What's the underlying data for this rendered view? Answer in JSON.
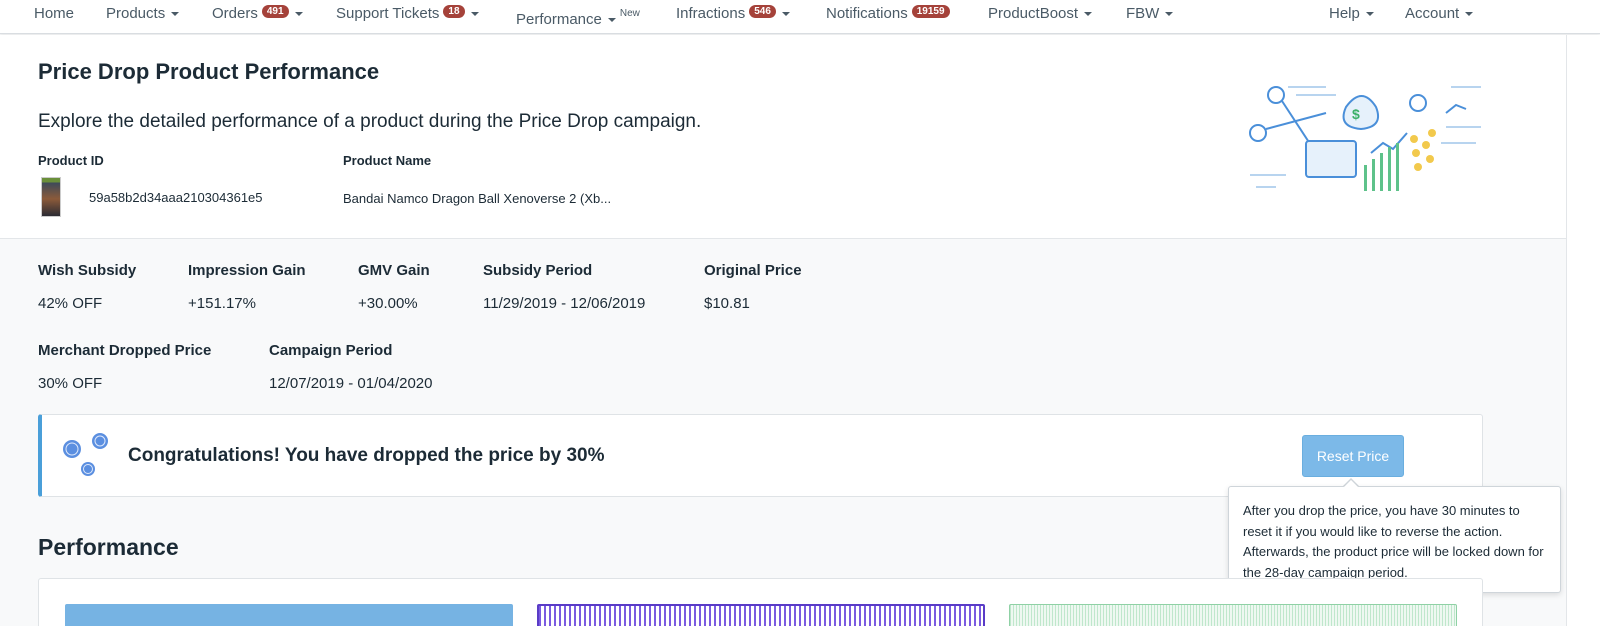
{
  "nav": {
    "home": "Home",
    "products": "Products",
    "orders": "Orders",
    "orders_badge": "491",
    "support": "Support Tickets",
    "support_badge": "18",
    "performance": "Performance",
    "performance_tag": "New",
    "infractions": "Infractions",
    "infractions_badge": "546",
    "notifications": "Notifications",
    "notifications_badge": "19159",
    "productboost": "ProductBoost",
    "fbw": "FBW",
    "help": "Help",
    "account": "Account"
  },
  "header": {
    "title": "Price Drop Product Performance",
    "description": "Explore the detailed performance of a product during the Price Drop campaign.",
    "product_id_label": "Product ID",
    "product_id": "59a58b2d34aaa210304361e5",
    "product_name_label": "Product Name",
    "product_name": "Bandai Namco Dragon Ball Xenoverse 2 (Xb..."
  },
  "stats": {
    "subsidy_label": "Wish Subsidy",
    "subsidy_value": "42% OFF",
    "impression_label": "Impression Gain",
    "impression_value": "+151.17%",
    "gmv_label": "GMV Gain",
    "gmv_value": "+30.00%",
    "subsidy_period_label": "Subsidy Period",
    "subsidy_period_value": "11/29/2019 - 12/06/2019",
    "original_price_label": "Original Price",
    "original_price_value": "$10.81",
    "merchant_price_label": "Merchant Dropped Price",
    "merchant_price_value": "30% OFF",
    "campaign_period_label": "Campaign Period",
    "campaign_period_value": "12/07/2019 - 01/04/2020"
  },
  "banner": {
    "message": "Congratulations! You have dropped the price by 30%",
    "reset_label": "Reset Price"
  },
  "tooltip": {
    "text": "After you drop the price, you have 30 minutes to reset it if you would like to reverse the action. Afterwards, the product price will be locked down for the 28-day campaign period."
  },
  "performance": {
    "title": "Performance"
  },
  "colors": {
    "accent": "#4a9fd9",
    "button": "#7cb9e8",
    "badge": "#a5423a"
  }
}
